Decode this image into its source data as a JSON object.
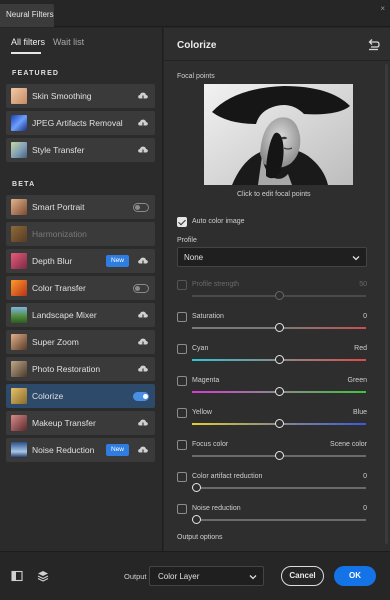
{
  "window": {
    "tab_title": "Neural Filters",
    "close_glyph": "×"
  },
  "left": {
    "tabs": [
      {
        "label": "All filters"
      },
      {
        "label": "Wait list"
      }
    ],
    "sections": {
      "featured": "FEATURED",
      "beta": "BETA"
    },
    "featured": [
      {
        "label": "Skin Smoothing",
        "icon": "cloud-download-icon"
      },
      {
        "label": "JPEG Artifacts Removal",
        "icon": "cloud-download-icon"
      },
      {
        "label": "Style Transfer",
        "icon": "cloud-download-icon"
      }
    ],
    "beta": [
      {
        "label": "Smart Portrait",
        "control": "toggle",
        "on": false
      },
      {
        "label": "Harmonization",
        "control": "none",
        "disabled": true
      },
      {
        "label": "Depth Blur",
        "control": "cloud",
        "badge": "New"
      },
      {
        "label": "Color Transfer",
        "control": "toggle",
        "on": false
      },
      {
        "label": "Landscape Mixer",
        "control": "cloud"
      },
      {
        "label": "Super Zoom",
        "control": "cloud"
      },
      {
        "label": "Photo Restoration",
        "control": "cloud"
      },
      {
        "label": "Colorize",
        "control": "toggle",
        "on": true,
        "selected": true
      },
      {
        "label": "Makeup Transfer",
        "control": "cloud"
      },
      {
        "label": "Noise Reduction",
        "control": "cloud",
        "badge": "New"
      }
    ]
  },
  "right": {
    "title": "Colorize",
    "focal_points_label": "Focal points",
    "focal_hint": "Click to edit focal points",
    "auto_color_label": "Auto color image",
    "profile_label": "Profile",
    "profile_value": "None",
    "sliders": [
      {
        "label": "Profile strength",
        "right": "50",
        "checked": false,
        "disabled": true,
        "value": 0.5
      },
      {
        "label": "Saturation",
        "right": "0",
        "checked": false,
        "value": 0.5,
        "gradient": "saturation"
      },
      {
        "label": "Cyan",
        "right": "Red",
        "checked": false,
        "value": 0.5,
        "gradient": "cyan-red"
      },
      {
        "label": "Magenta",
        "right": "Green",
        "checked": false,
        "value": 0.5,
        "gradient": "magenta-green"
      },
      {
        "label": "Yellow",
        "right": "Blue",
        "checked": false,
        "value": 0.5,
        "gradient": "yellow-blue"
      },
      {
        "label": "Focus color",
        "right": "Scene color",
        "checked": false,
        "value": 0.5,
        "gradient": "gray"
      },
      {
        "label": "Color artifact reduction",
        "right": "0",
        "checked": false,
        "value": 0.0,
        "gradient": "gray"
      },
      {
        "label": "Noise reduction",
        "right": "0",
        "checked": false,
        "value": 0.0,
        "gradient": "gray"
      }
    ],
    "output_options_label": "Output options"
  },
  "footer": {
    "output_label": "Output",
    "output_value": "Color Layer",
    "cancel_label": "Cancel",
    "ok_label": "OK"
  },
  "colors": {
    "accent": "#1473e6",
    "selected_row": "#2d4a6a",
    "new_badge": "#2f7de1"
  }
}
